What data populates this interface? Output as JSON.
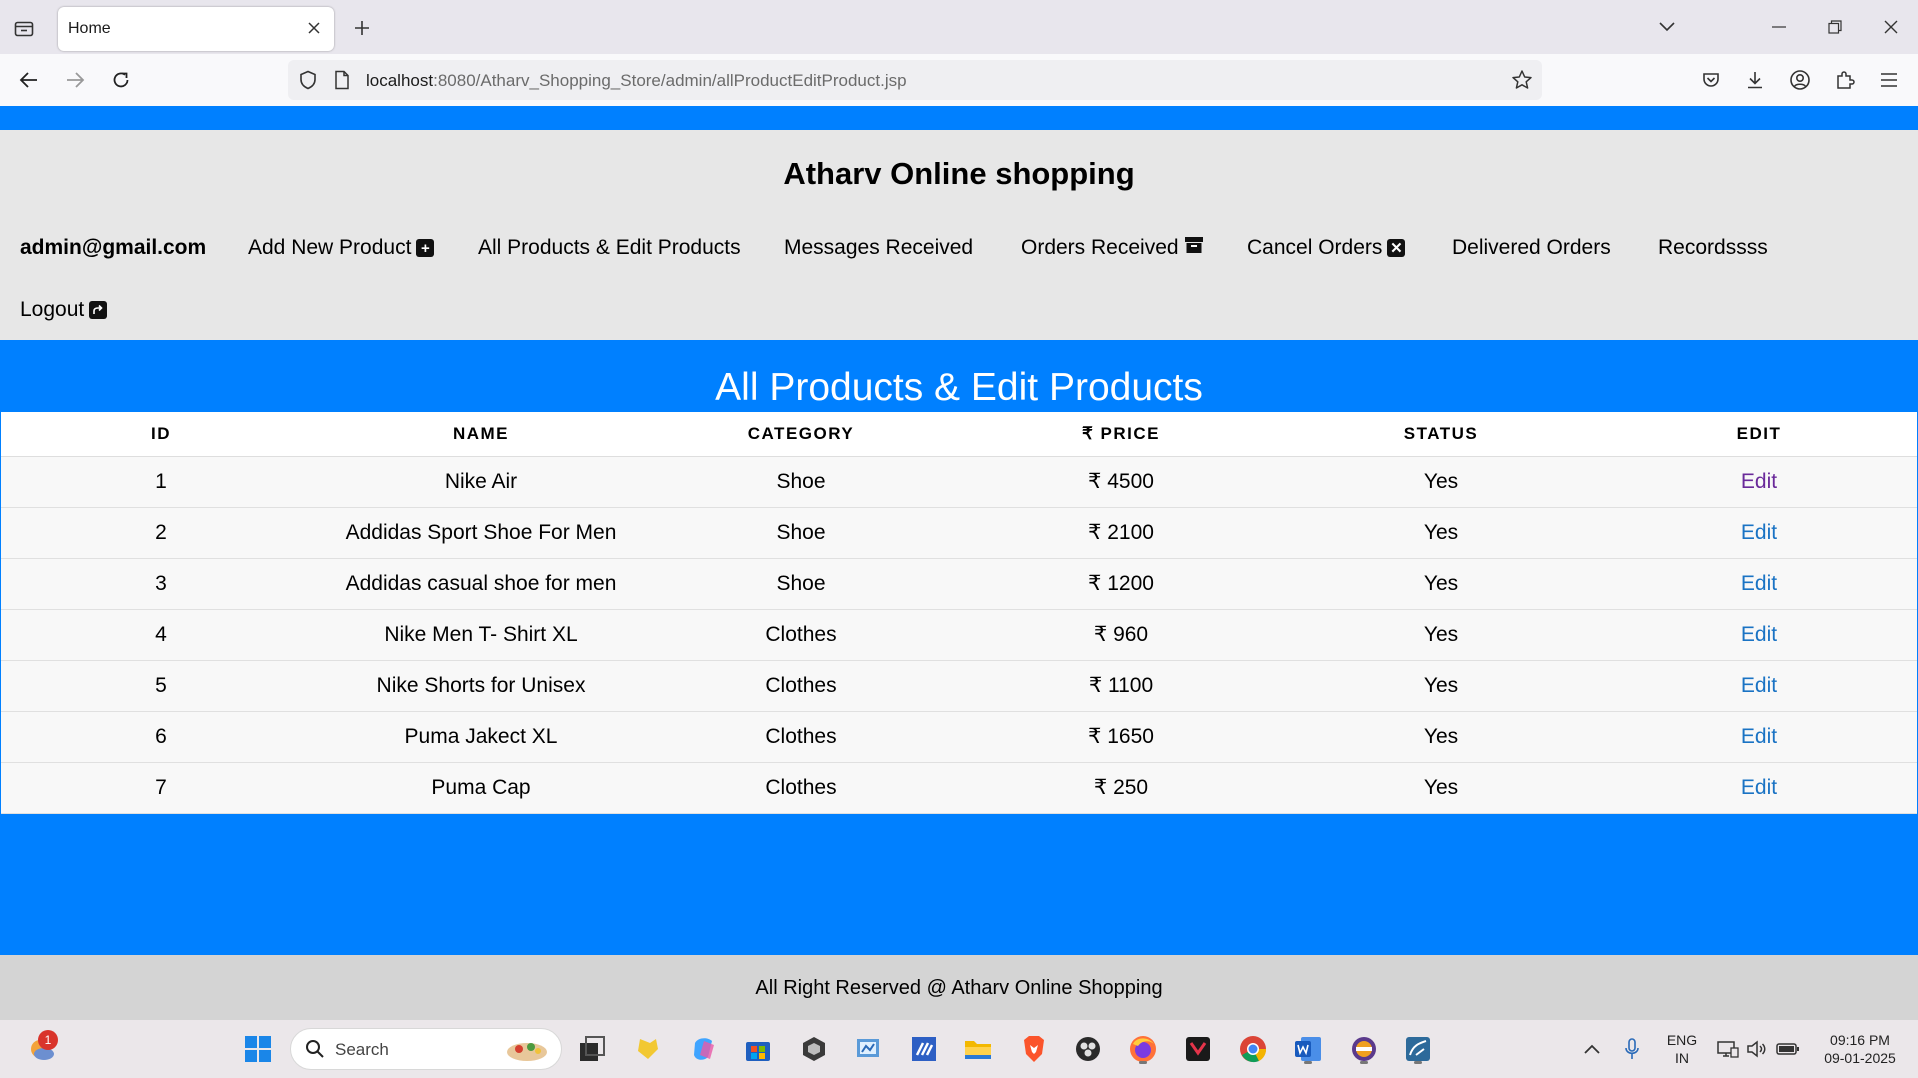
{
  "browser": {
    "tab_title": "Home",
    "url_host": "localhost",
    "url_rest": ":8080/Atharv_Shopping_Store/admin/allProductEditProduct.jsp"
  },
  "header": {
    "site_title": "Atharv Online shopping",
    "admin_email": "admin@gmail.com",
    "menu": {
      "add_new_product": "Add New Product",
      "all_products": "All Products & Edit Products",
      "messages": "Messages Received",
      "orders": "Orders Received",
      "cancel_orders": "Cancel Orders",
      "delivered": "Delivered Orders",
      "records": "Recordssss",
      "logout": "Logout"
    }
  },
  "main": {
    "heading": "All Products & Edit Products",
    "columns": {
      "id": "ID",
      "name": "NAME",
      "category": "CATEGORY",
      "price": "₹ PRICE",
      "status": "STATUS",
      "edit": "EDIT"
    },
    "rows": [
      {
        "id": "1",
        "name": "Nike Air",
        "category": "Shoe",
        "price": "₹ 4500",
        "status": "Yes",
        "edit": "Edit"
      },
      {
        "id": "2",
        "name": "Addidas Sport Shoe For Men",
        "category": "Shoe",
        "price": "₹ 2100",
        "status": "Yes",
        "edit": "Edit"
      },
      {
        "id": "3",
        "name": "Addidas casual shoe for men",
        "category": "Shoe",
        "price": "₹ 1200",
        "status": "Yes",
        "edit": "Edit"
      },
      {
        "id": "4",
        "name": "Nike Men T- Shirt XL",
        "category": "Clothes",
        "price": "₹ 960",
        "status": "Yes",
        "edit": "Edit"
      },
      {
        "id": "5",
        "name": "Nike Shorts for Unisex",
        "category": "Clothes",
        "price": "₹ 1100",
        "status": "Yes",
        "edit": "Edit"
      },
      {
        "id": "6",
        "name": "Puma Jakect XL",
        "category": "Clothes",
        "price": "₹ 1650",
        "status": "Yes",
        "edit": "Edit"
      },
      {
        "id": "7",
        "name": "Puma Cap",
        "category": "Clothes",
        "price": "₹ 250",
        "status": "Yes",
        "edit": "Edit"
      }
    ]
  },
  "footer": {
    "text": "All Right Reserved @ Atharv Online Shopping"
  },
  "taskbar": {
    "search_placeholder": "Search",
    "notification_count": "1",
    "language": "ENG",
    "region": "IN",
    "time": "09:16 PM",
    "date": "09-01-2025"
  },
  "colors": {
    "accent_blue": "#0080ff",
    "header_gray": "#e7e7e7",
    "link_blue": "#1a73c4",
    "link_visited": "#6a2a9a"
  }
}
